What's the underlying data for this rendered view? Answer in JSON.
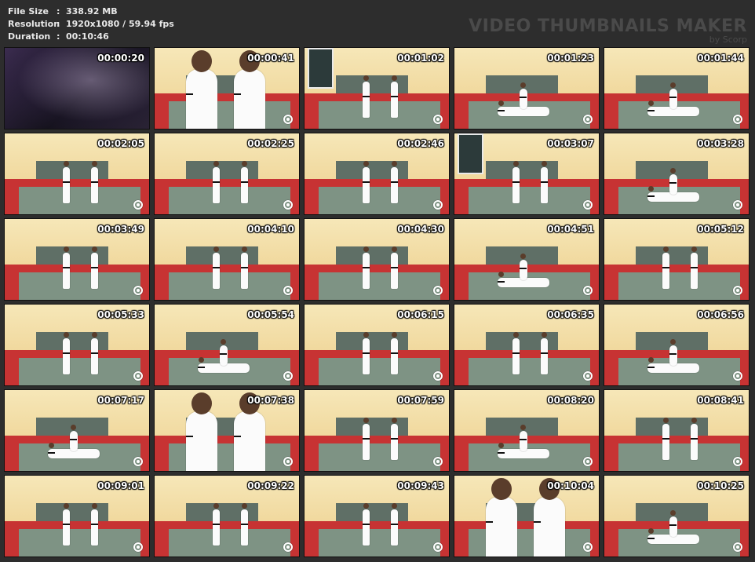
{
  "info": {
    "file_size_label": "File Size",
    "file_size_value": "338.92 MB",
    "resolution_label": "Resolution",
    "resolution_value": "1920x1080 / 59.94 fps",
    "duration_label": "Duration",
    "duration_value": "00:10:46",
    "separator": ":"
  },
  "brand": {
    "title": "VIDEO THUMBNAILS MAKER",
    "subtitle": "by Scorp"
  },
  "thumbnails": [
    {
      "time": "00:00:20",
      "scene": "intro",
      "icon": "logo-watermark-icon"
    },
    {
      "time": "00:00:41",
      "scene": "close",
      "icon": "logo-watermark-icon"
    },
    {
      "time": "00:01:02",
      "scene": "win",
      "icon": "logo-watermark-icon"
    },
    {
      "time": "00:01:23",
      "scene": "down",
      "icon": "logo-watermark-icon"
    },
    {
      "time": "00:01:44",
      "scene": "down",
      "icon": "logo-watermark-icon"
    },
    {
      "time": "00:02:05",
      "scene": "stand",
      "icon": "logo-watermark-icon"
    },
    {
      "time": "00:02:25",
      "scene": "stand",
      "icon": "logo-watermark-icon"
    },
    {
      "time": "00:02:46",
      "scene": "stand",
      "icon": "logo-watermark-icon"
    },
    {
      "time": "00:03:07",
      "scene": "win",
      "icon": "logo-watermark-icon"
    },
    {
      "time": "00:03:28",
      "scene": "down",
      "icon": "logo-watermark-icon"
    },
    {
      "time": "00:03:49",
      "scene": "stand",
      "icon": "logo-watermark-icon"
    },
    {
      "time": "00:04:10",
      "scene": "stand",
      "icon": "logo-watermark-icon"
    },
    {
      "time": "00:04:30",
      "scene": "stand",
      "icon": "logo-watermark-icon"
    },
    {
      "time": "00:04:51",
      "scene": "down",
      "icon": "logo-watermark-icon"
    },
    {
      "time": "00:05:12",
      "scene": "stand",
      "icon": "logo-watermark-icon"
    },
    {
      "time": "00:05:33",
      "scene": "stand",
      "icon": "logo-watermark-icon"
    },
    {
      "time": "00:05:54",
      "scene": "down",
      "icon": "logo-watermark-icon"
    },
    {
      "time": "00:06:15",
      "scene": "stand",
      "icon": "logo-watermark-icon"
    },
    {
      "time": "00:06:35",
      "scene": "stand",
      "icon": "logo-watermark-icon"
    },
    {
      "time": "00:06:56",
      "scene": "down",
      "icon": "logo-watermark-icon"
    },
    {
      "time": "00:07:17",
      "scene": "down",
      "icon": "logo-watermark-icon"
    },
    {
      "time": "00:07:38",
      "scene": "close",
      "icon": "logo-watermark-icon"
    },
    {
      "time": "00:07:59",
      "scene": "stand",
      "icon": "logo-watermark-icon"
    },
    {
      "time": "00:08:20",
      "scene": "down",
      "icon": "logo-watermark-icon"
    },
    {
      "time": "00:08:41",
      "scene": "stand",
      "icon": "logo-watermark-icon"
    },
    {
      "time": "00:09:01",
      "scene": "stand",
      "icon": "logo-watermark-icon"
    },
    {
      "time": "00:09:22",
      "scene": "stand",
      "icon": "logo-watermark-icon"
    },
    {
      "time": "00:09:43",
      "scene": "stand",
      "icon": "logo-watermark-icon"
    },
    {
      "time": "00:10:04",
      "scene": "close",
      "icon": "logo-watermark-icon"
    },
    {
      "time": "00:10:25",
      "scene": "down",
      "icon": "logo-watermark-icon"
    }
  ]
}
